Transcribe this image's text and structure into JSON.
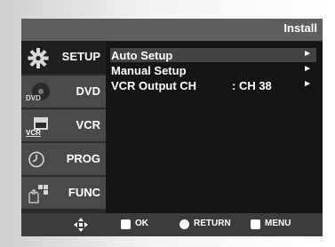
{
  "header": {
    "title": "Install"
  },
  "sidebar": {
    "items": [
      {
        "label": "SETUP",
        "icon": "gear-icon",
        "active": true
      },
      {
        "label": "DVD",
        "icon": "dvd-disc-icon",
        "icon_text": "DVD",
        "active": false
      },
      {
        "label": "VCR",
        "icon": "vcr-cassette-icon",
        "icon_text": "VCR",
        "active": false
      },
      {
        "label": "PROG",
        "icon": "clock-icon",
        "active": false
      },
      {
        "label": "FUNC",
        "icon": "function-hand-icon",
        "active": false
      }
    ]
  },
  "menu": {
    "items": [
      {
        "label": "Auto Setup",
        "value": "",
        "highlighted": true
      },
      {
        "label": "Manual Setup",
        "value": "",
        "highlighted": false
      },
      {
        "label": "VCR Output CH",
        "value": ": CH 38",
        "highlighted": false
      }
    ],
    "arrow": "►"
  },
  "footer": {
    "nav_icon": "directional-pad-icon",
    "ok": {
      "label": "OK",
      "icon": "ok-button-icon"
    },
    "return": {
      "label": "RETURN",
      "icon": "return-button-icon"
    },
    "menu": {
      "label": "MENU",
      "icon": "menu-button-icon"
    }
  },
  "colors": {
    "header": "#5e5e5e",
    "sidebar_inactive": "#4a4a4a",
    "sidebar_active": "#1f1f1f",
    "highlight": "#424242",
    "footer": "#3c3c3c",
    "text": "#ffffff"
  }
}
